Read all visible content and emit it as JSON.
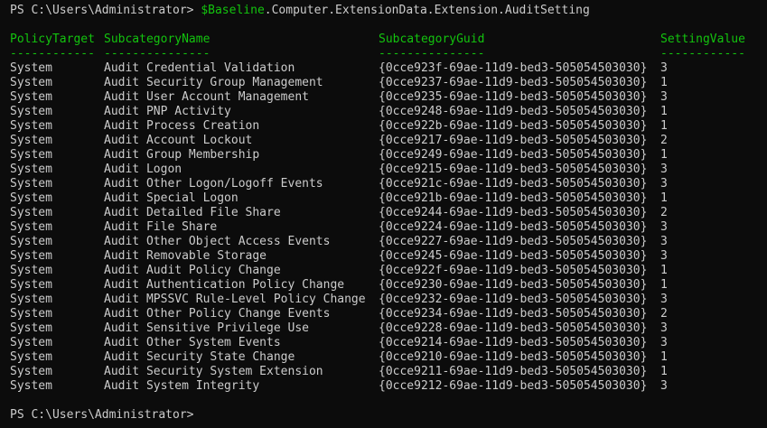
{
  "terminal": {
    "prompt": "PS C:\\Users\\Administrator> ",
    "command_var": "$Baseline",
    "command_rest": ".Computer.ExtensionData.Extension.AuditSetting",
    "colors": {
      "background": "#0c0c0c",
      "text": "#cccccc",
      "header": "#13c40e",
      "variable": "#13c40e"
    },
    "headers": [
      "PolicyTarget",
      "SubcategoryName",
      "SubcategoryGuid",
      "SettingValue"
    ],
    "underlines": [
      "------------",
      "---------------",
      "---------------",
      "------------"
    ],
    "rows": [
      [
        "System",
        "Audit Credential Validation",
        "{0cce923f-69ae-11d9-bed3-505054503030}",
        "3"
      ],
      [
        "System",
        "Audit Security Group Management",
        "{0cce9237-69ae-11d9-bed3-505054503030}",
        "1"
      ],
      [
        "System",
        "Audit User Account Management",
        "{0cce9235-69ae-11d9-bed3-505054503030}",
        "3"
      ],
      [
        "System",
        "Audit PNP Activity",
        "{0cce9248-69ae-11d9-bed3-505054503030}",
        "1"
      ],
      [
        "System",
        "Audit Process Creation",
        "{0cce922b-69ae-11d9-bed3-505054503030}",
        "1"
      ],
      [
        "System",
        "Audit Account Lockout",
        "{0cce9217-69ae-11d9-bed3-505054503030}",
        "2"
      ],
      [
        "System",
        "Audit Group Membership",
        "{0cce9249-69ae-11d9-bed3-505054503030}",
        "1"
      ],
      [
        "System",
        "Audit Logon",
        "{0cce9215-69ae-11d9-bed3-505054503030}",
        "3"
      ],
      [
        "System",
        "Audit Other Logon/Logoff Events",
        "{0cce921c-69ae-11d9-bed3-505054503030}",
        "3"
      ],
      [
        "System",
        "Audit Special Logon",
        "{0cce921b-69ae-11d9-bed3-505054503030}",
        "1"
      ],
      [
        "System",
        "Audit Detailed File Share",
        "{0cce9244-69ae-11d9-bed3-505054503030}",
        "2"
      ],
      [
        "System",
        "Audit File Share",
        "{0cce9224-69ae-11d9-bed3-505054503030}",
        "3"
      ],
      [
        "System",
        "Audit Other Object Access Events",
        "{0cce9227-69ae-11d9-bed3-505054503030}",
        "3"
      ],
      [
        "System",
        "Audit Removable Storage",
        "{0cce9245-69ae-11d9-bed3-505054503030}",
        "3"
      ],
      [
        "System",
        "Audit Audit Policy Change",
        "{0cce922f-69ae-11d9-bed3-505054503030}",
        "1"
      ],
      [
        "System",
        "Audit Authentication Policy Change",
        "{0cce9230-69ae-11d9-bed3-505054503030}",
        "1"
      ],
      [
        "System",
        "Audit MPSSVC Rule-Level Policy Change",
        "{0cce9232-69ae-11d9-bed3-505054503030}",
        "3"
      ],
      [
        "System",
        "Audit Other Policy Change Events",
        "{0cce9234-69ae-11d9-bed3-505054503030}",
        "2"
      ],
      [
        "System",
        "Audit Sensitive Privilege Use",
        "{0cce9228-69ae-11d9-bed3-505054503030}",
        "3"
      ],
      [
        "System",
        "Audit Other System Events",
        "{0cce9214-69ae-11d9-bed3-505054503030}",
        "3"
      ],
      [
        "System",
        "Audit Security State Change",
        "{0cce9210-69ae-11d9-bed3-505054503030}",
        "1"
      ],
      [
        "System",
        "Audit Security System Extension",
        "{0cce9211-69ae-11d9-bed3-505054503030}",
        "1"
      ],
      [
        "System",
        "Audit System Integrity",
        "{0cce9212-69ae-11d9-bed3-505054503030}",
        "3"
      ]
    ],
    "final_prompt": "PS C:\\Users\\Administrator>"
  }
}
